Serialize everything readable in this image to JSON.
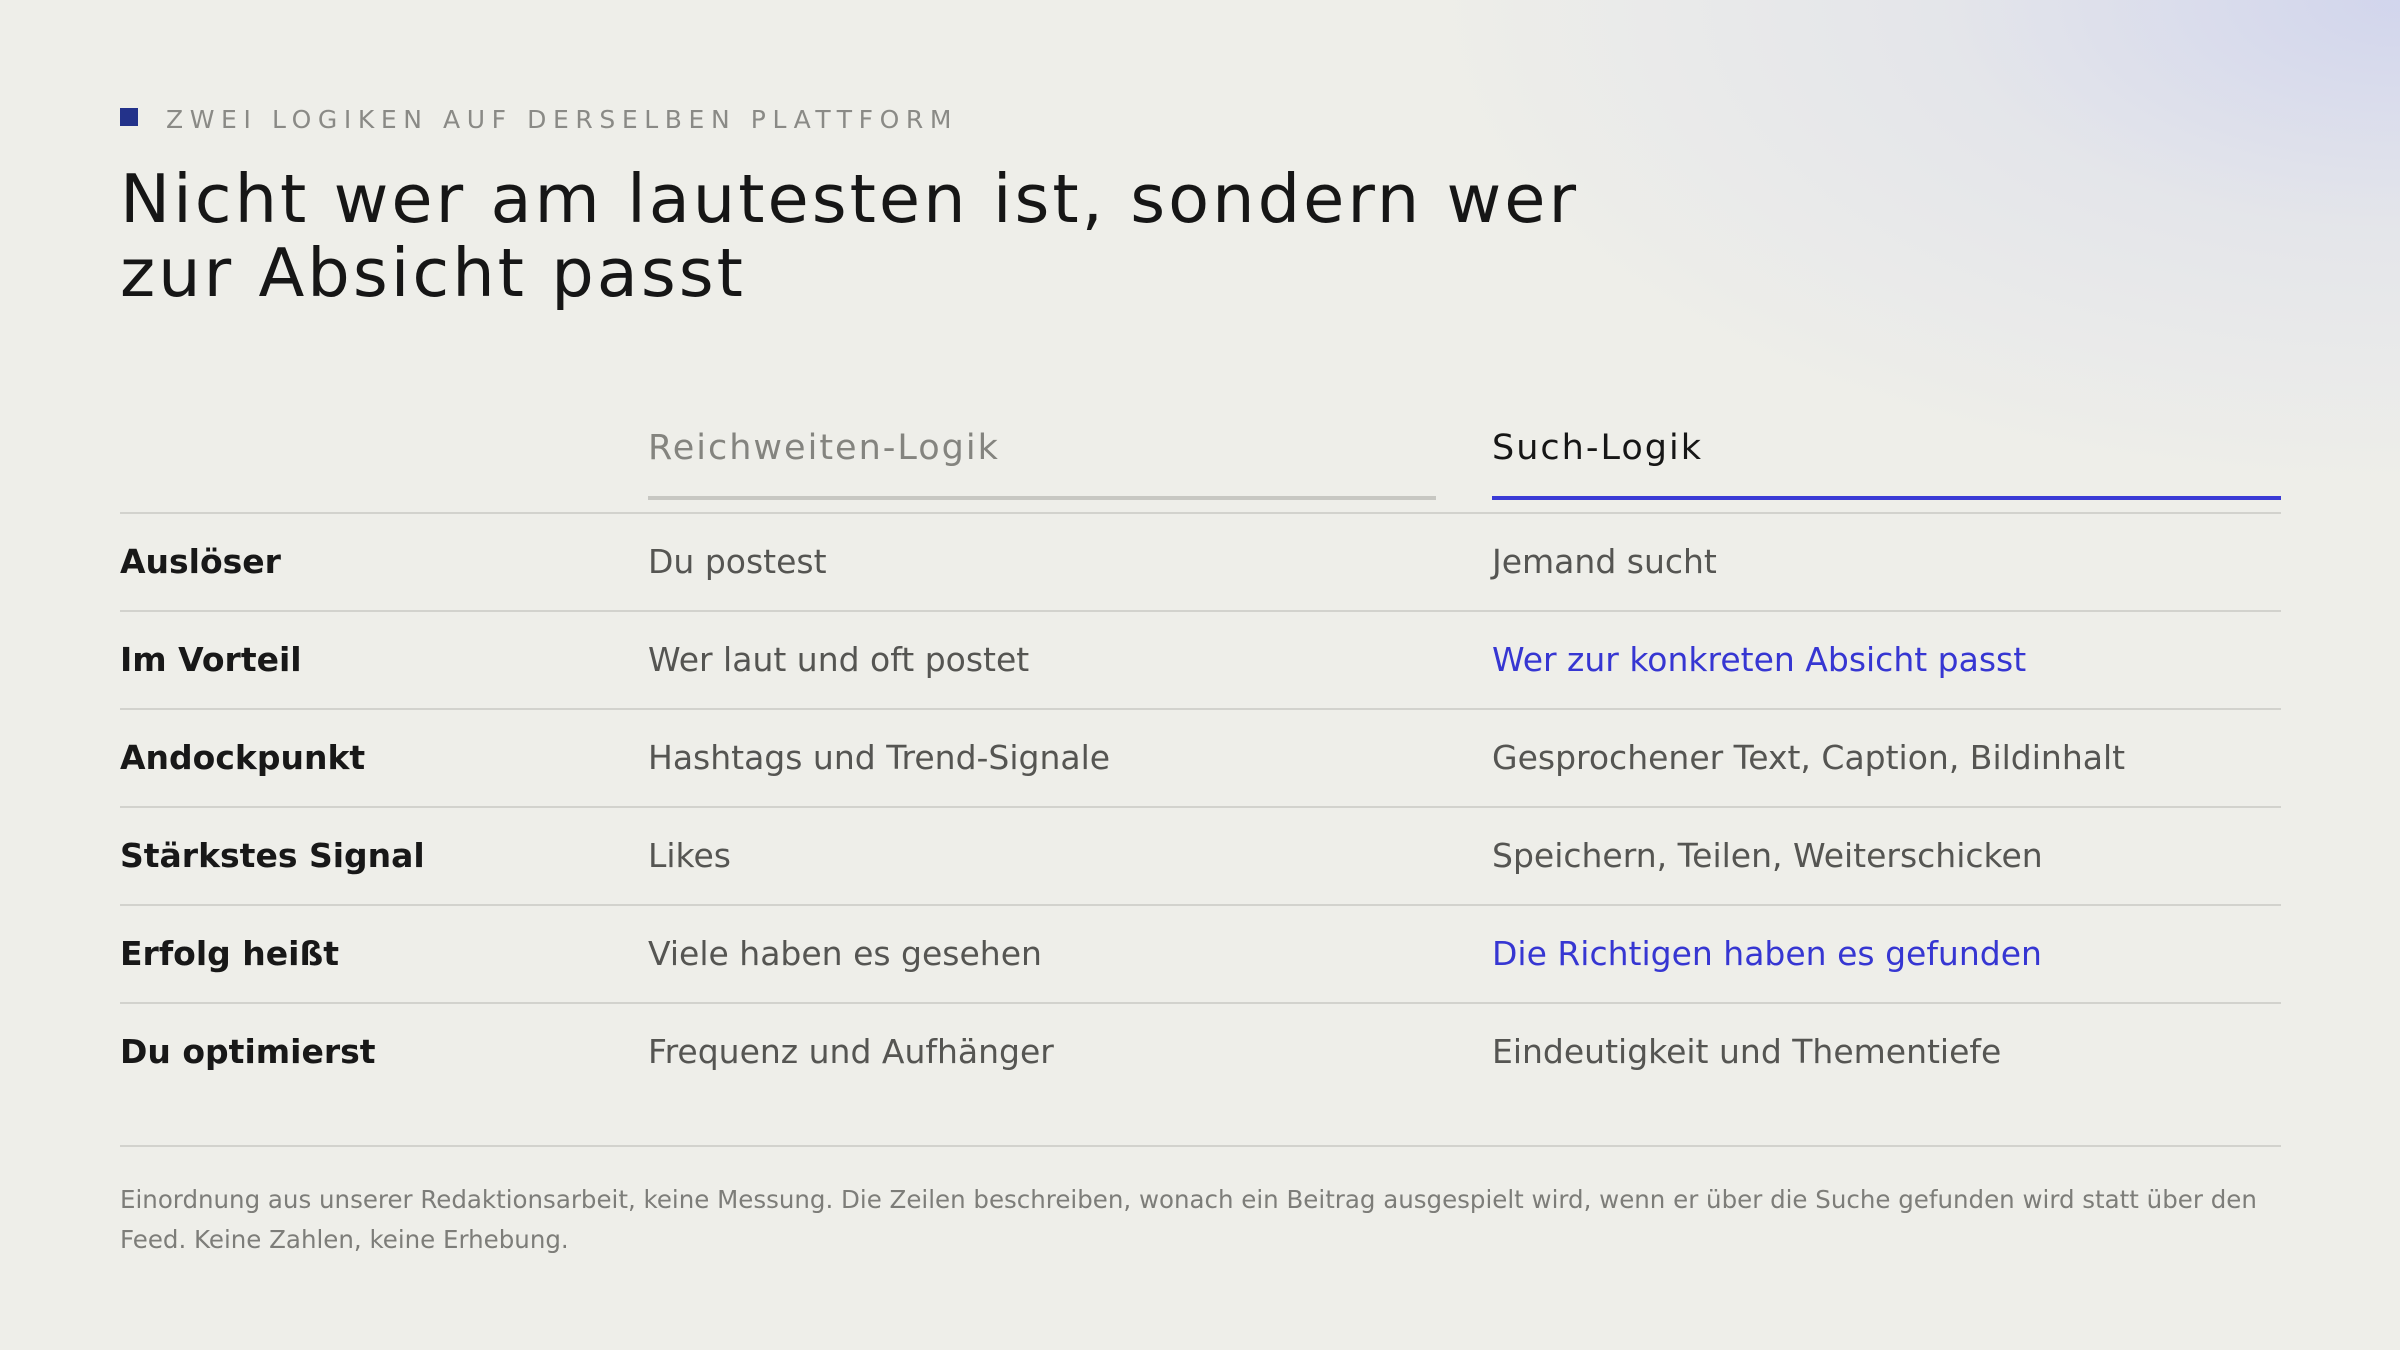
{
  "kicker": "ZWEI LOGIKEN AUF DERSELBEN PLATTFORM",
  "title": {
    "line1": "Nicht wer am lautesten ist, sondern wer",
    "line2": "zur Absicht passt"
  },
  "columns": {
    "reach": "Reichweiten-Logik",
    "search": "Such-Logik"
  },
  "rows": [
    {
      "label": "Auslöser",
      "reach": "Du postest",
      "search": "Jemand sucht",
      "search_highlight": false
    },
    {
      "label": "Im Vorteil",
      "reach": "Wer laut und oft postet",
      "search": "Wer zur konkreten Absicht passt",
      "search_highlight": true
    },
    {
      "label": "Andockpunkt",
      "reach": "Hashtags und Trend-Signale",
      "search": "Gesprochener Text, Caption, Bildinhalt",
      "search_highlight": false
    },
    {
      "label": "Stärkstes Signal",
      "reach": "Likes",
      "search": "Speichern, Teilen, Weiterschicken",
      "search_highlight": false
    },
    {
      "label": "Erfolg heißt",
      "reach": "Viele haben es gesehen",
      "search": "Die Richtigen haben es gefunden",
      "search_highlight": true
    },
    {
      "label": "Du optimierst",
      "reach": "Frequenz und Aufhänger",
      "search": "Eindeutigkeit und Thementiefe",
      "search_highlight": false
    }
  ],
  "footnote": "Einordnung aus unserer Redaktionsarbeit, keine Messung. Die Zeilen beschreiben, wonach ein Beitrag ausgespielt wird, wenn er über die Suche gefunden wird statt über den Feed. Keine Zahlen, keine Erhebung.",
  "colors": {
    "background": "#eeeee9",
    "accent": "#3636d2",
    "kicker_square": "#23328a",
    "text_dark": "#161616",
    "text_muted": "#555552"
  }
}
